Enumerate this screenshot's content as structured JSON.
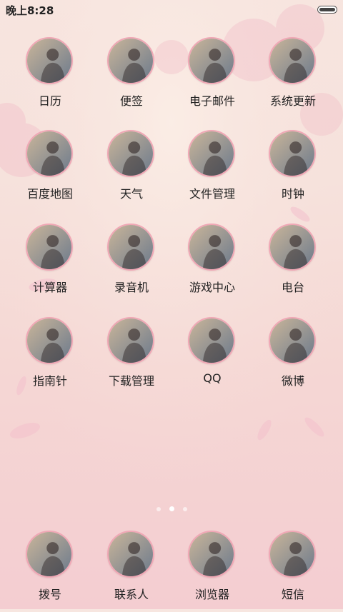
{
  "status_bar": {
    "time": "晚上8:28"
  },
  "apps": [
    {
      "label": "日历",
      "icon": "calendar-icon",
      "c1": "#c9b59a",
      "c2": "#6c7a8c"
    },
    {
      "label": "便签",
      "icon": "notes-icon",
      "c1": "#d7c9b8",
      "c2": "#8a6f55"
    },
    {
      "label": "电子邮件",
      "icon": "email-icon",
      "c1": "#d2c8c0",
      "c2": "#3c3a3a"
    },
    {
      "label": "系统更新",
      "icon": "system-update-icon",
      "c1": "#cfe1d8",
      "c2": "#4d6a70"
    },
    {
      "label": "百度地图",
      "icon": "baidu-map-icon",
      "c1": "#d9d3cc",
      "c2": "#2f2f2f"
    },
    {
      "label": "天气",
      "icon": "weather-icon",
      "c1": "#9fb9c1",
      "c2": "#3f3e3c"
    },
    {
      "label": "文件管理",
      "icon": "file-manager-icon",
      "c1": "#a8c7a2",
      "c2": "#6b5a4a"
    },
    {
      "label": "时钟",
      "icon": "clock-icon",
      "c1": "#c9c1b8",
      "c2": "#4b3a35"
    },
    {
      "label": "计算器",
      "icon": "calculator-icon",
      "c1": "#e4b8b6",
      "c2": "#b4262b"
    },
    {
      "label": "录音机",
      "icon": "recorder-icon",
      "c1": "#e8d4c2",
      "c2": "#c09a7a"
    },
    {
      "label": "游戏中心",
      "icon": "game-center-icon",
      "c1": "#e7e3dd",
      "c2": "#535967"
    },
    {
      "label": "电台",
      "icon": "radio-icon",
      "c1": "#f1c06a",
      "c2": "#7d5730"
    },
    {
      "label": "指南针",
      "icon": "compass-icon",
      "c1": "#c9c6bf",
      "c2": "#242424"
    },
    {
      "label": "下载管理",
      "icon": "download-manager-icon",
      "c1": "#b8a9ad",
      "c2": "#5a4c52"
    },
    {
      "label": "QQ",
      "icon": "qq-icon",
      "c1": "#d7dee4",
      "c2": "#9b6a45"
    },
    {
      "label": "微博",
      "icon": "weibo-icon",
      "c1": "#ece2dd",
      "c2": "#5d3d3c"
    }
  ],
  "dock": [
    {
      "label": "拨号",
      "icon": "dialer-icon",
      "c1": "#c6d4d8",
      "c2": "#4a4a4a"
    },
    {
      "label": "联系人",
      "icon": "contacts-icon",
      "c1": "#f1e3cf",
      "c2": "#d8c2a6"
    },
    {
      "label": "浏览器",
      "icon": "browser-icon",
      "c1": "#e9d7cf",
      "c2": "#c7a16f"
    },
    {
      "label": "短信",
      "icon": "messages-icon",
      "c1": "#cfd6e4",
      "c2": "#f0f2f6"
    }
  ],
  "page_indicator": {
    "pages": 3,
    "active_index": 1
  }
}
